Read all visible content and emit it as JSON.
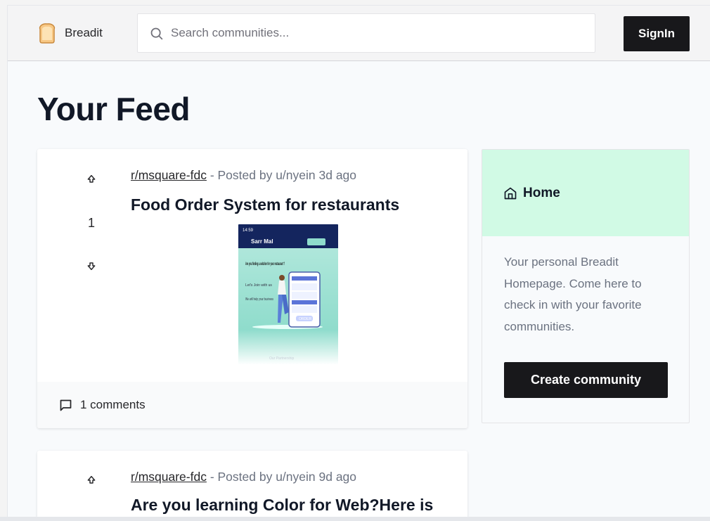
{
  "header": {
    "brand": "Breadit",
    "search_placeholder": "Search communities...",
    "signin_label": "SignIn"
  },
  "feed": {
    "title": "Your Feed",
    "posts": [
      {
        "subreddit": "r/msquare-fdc",
        "meta": " - Posted by u/nyein 3d ago",
        "title": "Food Order System for restaurants",
        "votes": "1",
        "comments": "1 comments",
        "image": {
          "time": "14:59",
          "brand": "Sarr Mal",
          "headline": "Are you finding a solution for your restaurant ?",
          "subline": "Let's Join with us",
          "help": "We will help your business",
          "button": "ORDER",
          "footer": "Our Partnership"
        }
      },
      {
        "subreddit": "r/msquare-fdc",
        "meta": " - Posted by u/nyein 9d ago",
        "title": "Are you learning Color for Web?Here is"
      }
    ]
  },
  "sidebar": {
    "title": "Home",
    "description": "Your personal Breadit Homepage. Come here to check in with your favorite communities.",
    "create_label": "Create community"
  },
  "colors": {
    "accent_dark": "#18181b",
    "sidebar_header": "#d1fae5",
    "muted_text": "#6b7280"
  }
}
